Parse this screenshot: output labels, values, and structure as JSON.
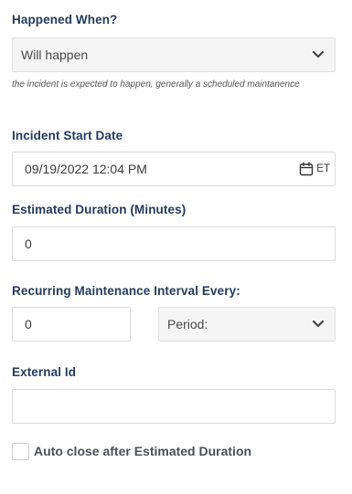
{
  "happened_when": {
    "label": "Happened When?",
    "selected": "Will happen",
    "helper": "the incident is expected to happen, generally a scheduled maintanence"
  },
  "start_date": {
    "label": "Incident Start Date",
    "value": "09/19/2022 12:04 PM",
    "timezone": "ET",
    "icon": "calendar-icon"
  },
  "duration": {
    "label": "Estimated Duration (Minutes)",
    "value": "0"
  },
  "recurring": {
    "label": "Recurring Maintenance Interval Every:",
    "value": "0",
    "period_placeholder": "Period:"
  },
  "external_id": {
    "label": "External Id",
    "value": ""
  },
  "auto_close": {
    "label": "Auto close after Estimated Duration",
    "checked": false
  },
  "colors": {
    "label": "#253a5e",
    "select_bg": "#f5f5f5",
    "border": "#dcdcdc"
  }
}
